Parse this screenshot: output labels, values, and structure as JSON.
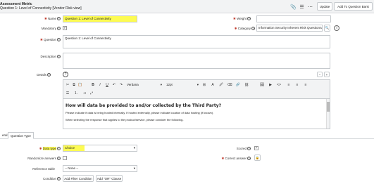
{
  "header": {
    "title": "Assessment Metric",
    "subtitle": "Question 1: Level of Connectivity [Vendor Risk view]",
    "update_label": "Update",
    "add_label": "Add To Question Bank"
  },
  "form": {
    "name_label": "Name",
    "name_value": "Question 1: Level of Connectivity",
    "weight_label": "Weight",
    "mandatory_label": "Mandatory",
    "category_label": "Category",
    "category_value": "Information Security Inherent Risk Questionna",
    "question_label": "Question",
    "question_value": "Question 1: Level of Connectivity",
    "description_label": "Description",
    "details_label": "Details"
  },
  "editor": {
    "font_family": "Verdana",
    "font_size": "12pt",
    "heading": "How will data be provided to and/or collected by the Third Party?",
    "line1": "Please indicate if data is being hosted internally.  If hosted externally, please indicate location of data hosting (if known).",
    "line2": "When selecting the response that applies to the product/service, please consider the following-"
  },
  "tabs": [
    "eral",
    "Question Type"
  ],
  "question_type": {
    "data_type_label": "Data type",
    "data_type_value": "Choice",
    "scored_label": "Scored",
    "randomize_label": "Randomize answers",
    "correct_answer_label": "Correct answer",
    "reference_table_label": "Reference table",
    "reference_table_value": "-- None --",
    "condition_label": "Condition",
    "add_filter_label": "Add Filter Condition",
    "add_or_label": "Add \"OR\" Clause"
  },
  "colors": {
    "highlight": "#fdfb52",
    "header_bg": "#f2f3f4",
    "required": "#c0392b"
  }
}
